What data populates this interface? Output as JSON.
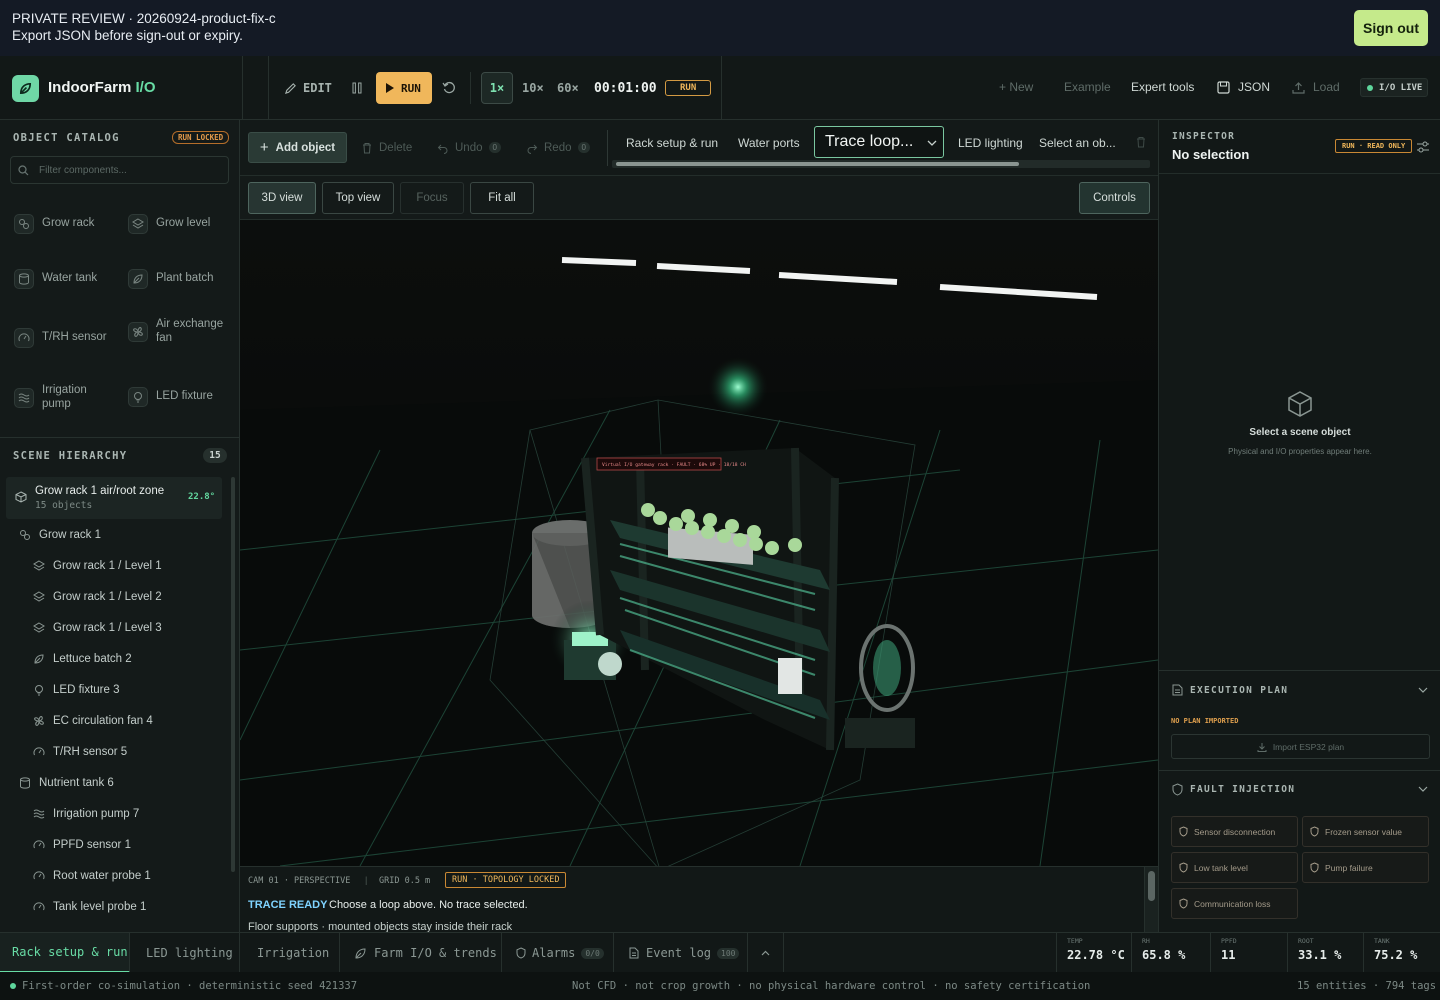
{
  "banner": {
    "line1": "PRIVATE REVIEW · 20260924-product-fix-c",
    "line2": "Export JSON before sign-out or expiry.",
    "signout": "Sign out"
  },
  "app": {
    "name_a": "IndoorFarm ",
    "name_b": "I/O"
  },
  "topbar": {
    "edit": "EDIT",
    "run": "RUN",
    "speeds": [
      "1×",
      "10×",
      "60×"
    ],
    "clock": "00:01:00",
    "mode": "RUN",
    "new": "New",
    "example": "Example",
    "expert": "Expert tools",
    "json": "JSON",
    "load": "Load",
    "live": "I/O LIVE"
  },
  "catalog": {
    "title": "OBJECT CATALOG",
    "badge": "RUN LOCKED",
    "filter_placeholder": "Filter components...",
    "items": [
      "Grow rack",
      "Grow level",
      "Water tank",
      "Plant batch",
      "T/RH sensor",
      "Air exchange fan",
      "Irrigation pump",
      "LED fixture"
    ]
  },
  "hierarchy": {
    "title": "SCENE HIERARCHY",
    "count": "15",
    "root": {
      "name": "Grow rack 1 air/root zone",
      "sub": "15 objects",
      "temp": "22.8°"
    },
    "items": [
      "Grow rack 1",
      "Grow rack 1 / Level 1",
      "Grow rack 1 / Level 2",
      "Grow rack 1 / Level 3",
      "Lettuce batch 2",
      "LED fixture 3",
      "EC circulation fan 4",
      "T/RH sensor 5",
      "Nutrient tank 6",
      "Irrigation pump 7",
      "PPFD sensor 1",
      "Root water probe 1",
      "Tank level probe 1"
    ]
  },
  "toolbar": {
    "add": "Add object",
    "delete": "Delete",
    "undo": "Undo",
    "undo_n": "0",
    "redo": "Redo",
    "redo_n": "0",
    "tabs": [
      "Rack setup & run",
      "Water ports"
    ],
    "select": "Trace loop...",
    "led": "LED lighting",
    "selectob": "Select an ob..."
  },
  "viewbar": {
    "v3d": "3D view",
    "top": "Top view",
    "focus": "Focus",
    "fit": "Fit all",
    "controls": "Controls"
  },
  "scene": {
    "label": "Virtual I/O gateway rack · FAULT · 68% UP · 18/18 CH"
  },
  "console": {
    "cam": "CAM 01 · PERSPECTIVE",
    "grid": "GRID 0.5 m",
    "lock": "RUN · TOPOLOGY LOCKED",
    "trace": "TRACE READY",
    "trace_msg": "Choose a loop above. No trace selected.",
    "floor": "Floor supports · mounted objects stay inside their rack"
  },
  "inspector": {
    "title": "INSPECTOR",
    "sub": "No selection",
    "badge": "RUN · READ ONLY",
    "empty_title": "Select a scene object",
    "empty_sub": "Physical and I/O properties appear here.",
    "plan_title": "EXECUTION PLAN",
    "plan_state": "NO PLAN IMPORTED",
    "plan_btn": "Import ESP32 plan",
    "fault_title": "FAULT INJECTION",
    "faults": [
      "Sensor disconnection",
      "Frozen sensor value",
      "Low tank level",
      "Pump failure",
      "Communication loss"
    ]
  },
  "bottom": {
    "tabs": [
      "Rack setup & run",
      "LED lighting",
      "Irrigation",
      "Farm I/O & trends",
      "Alarms",
      "Event log"
    ],
    "alarms_n": "0/0",
    "events_n": "100",
    "metrics": [
      {
        "label": "TEMP",
        "value": "22.78 °C"
      },
      {
        "label": "RH",
        "value": "65.8 %"
      },
      {
        "label": "PPFD",
        "value": "11"
      },
      {
        "label": "ROOT",
        "value": "33.1 %"
      },
      {
        "label": "TANK",
        "value": "75.2 %"
      }
    ]
  },
  "status": {
    "left": "First-order co-simulation · deterministic seed 421337",
    "mid": "Not CFD · not crop growth · no physical hardware control · no safety certification",
    "right": "15 entities · 794 tags"
  }
}
